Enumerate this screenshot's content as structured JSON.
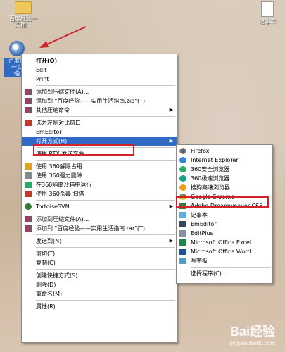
{
  "desktop": {
    "folder_label_1": "百度经验一",
    "folder_label_2": "实用...",
    "doc_label": "记事本",
    "selected_label_1": "百度经",
    "selected_label_2": "一实",
    "selected_label_3": "指"
  },
  "menu": {
    "open": "打开(O)",
    "edit": "Edit",
    "print": "Print",
    "add_archive": "添加到压缩文件(A)...",
    "add_zip": "添加到 \"百度经验——实用生活指南.zip\"(T)",
    "other_compress": "其他压缩命令",
    "select_left_compare": "选为左侧对比窗口",
    "emeditor": "EmEditor",
    "open_with": "打开方式(H)",
    "rtx_send": "使用 RTX 发送文件",
    "unlock_360": "使用 360解除占用",
    "force_delete_360": "使用 360强力删除",
    "sandbox_360": "在360隔离沙箱中运行",
    "scan_360": "使用 360杀毒 扫描",
    "tortoise": "TortoiseSVN",
    "add_archive2": "添加到压缩文件(A)...",
    "add_rar": "添加到 \"百度经验——实用生活指南.rar\"(T)",
    "send_to": "发送到(N)",
    "cut": "剪切(T)",
    "copy": "复制(C)",
    "create_shortcut": "创建快捷方式(S)",
    "delete": "删除(D)",
    "rename": "重命名(M)",
    "properties": "属性(R)"
  },
  "submenu": {
    "firefox": "Firefox",
    "ie": "Internet Explorer",
    "safe360": "360安全浏览器",
    "fast360": "360极速浏览器",
    "sogou": "搜狗高速浏览器",
    "chrome": "Google Chrome",
    "dreamweaver": "Adobe Dreamweaver CS5",
    "notepad": "记事本",
    "emeditor": "EmEditor",
    "editplus": "EditPlus",
    "excel": "Microsoft Office Excel",
    "word": "Microsoft Office Word",
    "wordpad": "写字板",
    "choose_program": "选择程序(C)..."
  },
  "watermark": {
    "brand": "Bai经验",
    "url": "jingyan.baidu.com"
  },
  "colors": {
    "highlight": "#3169c6",
    "annotation_red": "#d0242a"
  }
}
